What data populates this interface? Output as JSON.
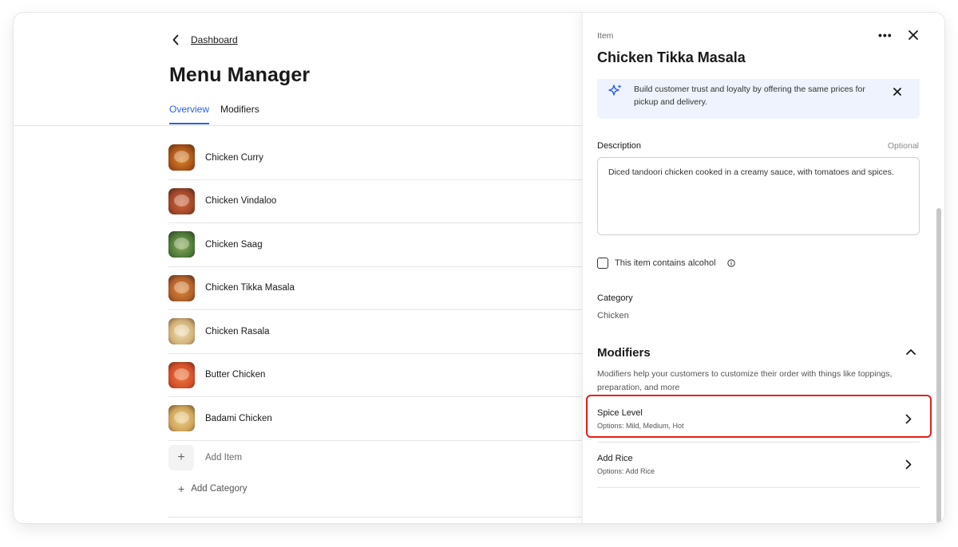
{
  "breadcrumb": {
    "back_label": "Dashboard"
  },
  "page": {
    "title": "Menu Manager"
  },
  "tabs": [
    {
      "label": "Overview",
      "active": true
    },
    {
      "label": "Modifiers",
      "active": false
    }
  ],
  "menu_items": [
    {
      "name": "Chicken Curry",
      "thumb_color": "#c9711f"
    },
    {
      "name": "Chicken Vindaloo",
      "thumb_color": "#b5522a"
    },
    {
      "name": "Chicken Saag",
      "thumb_color": "#6d8a4a"
    },
    {
      "name": "Chicken Tikka Masala",
      "thumb_color": "#b8642a"
    },
    {
      "name": "Chicken Rasala",
      "thumb_color": "#d7c08e"
    },
    {
      "name": "Butter Chicken",
      "thumb_color": "#d8572b"
    },
    {
      "name": "Badami Chicken",
      "thumb_color": "#d2a860"
    }
  ],
  "add_item_label": "Add Item",
  "add_category_label": "Add Category",
  "panel": {
    "eyebrow": "Item",
    "title": "Chicken Tikka Masala",
    "banner_text": "Build customer trust and loyalty by offering the same prices for pickup and delivery.",
    "description_label": "Description",
    "optional_label": "Optional",
    "description_value": "Diced tandoori chicken cooked in a creamy sauce, with tomatoes and spices.",
    "alcohol_label": "This item contains alcohol",
    "alcohol_checked": false,
    "category_label": "Category",
    "category_value": "Chicken",
    "modifiers_title": "Modifiers",
    "modifiers_desc": "Modifiers help your customers to customize their order with things like toppings, preparation, and more",
    "modifiers": [
      {
        "name": "Spice Level",
        "options": "Options: Mild, Medium, Hot"
      },
      {
        "name": "Add Rice",
        "options": "Options: Add Rice"
      }
    ]
  },
  "colors": {
    "accent": "#2c5fe0",
    "highlight": "#e0201c",
    "banner_bg": "#eef3fd"
  }
}
